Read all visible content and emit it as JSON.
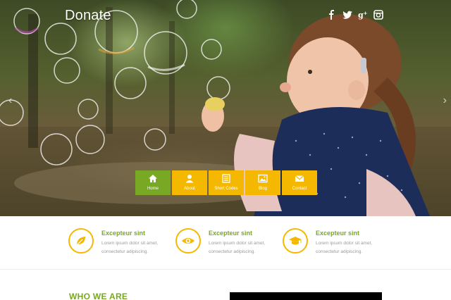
{
  "site": {
    "logo": "Donate"
  },
  "social": [
    {
      "label": "f",
      "icon": "facebook-icon"
    },
    {
      "label": "t",
      "icon": "twitter-icon"
    },
    {
      "label": "g+",
      "icon": "google-plus-icon"
    },
    {
      "label": "ig",
      "icon": "instagram-icon"
    }
  ],
  "slider": {
    "prev": "‹",
    "next": "›"
  },
  "nav": [
    {
      "label": "Home",
      "icon": "home-icon",
      "active": true
    },
    {
      "label": "About",
      "icon": "user-icon"
    },
    {
      "label": "Short Codes",
      "icon": "list-icon"
    },
    {
      "label": "Blog",
      "icon": "image-icon"
    },
    {
      "label": "Contact",
      "icon": "envelope-icon"
    }
  ],
  "features": [
    {
      "title": "Excepteur sint",
      "line1": "Lorem ipsum dolor sit amet,",
      "line2": "consectetur adipiscing.",
      "icon": "leaf-icon"
    },
    {
      "title": "Excepteur sint",
      "line1": "Lorem ipsum dolor sit amet,",
      "line2": "consectetur adipiscing.",
      "icon": "eye-icon"
    },
    {
      "title": "Excepteur sint",
      "line1": "Lorem ipsum dolor sit amet,",
      "line2": "consectetur adipiscing.",
      "icon": "graduation-cap-icon"
    }
  ],
  "section": {
    "who_we_are": "WHO WE ARE"
  },
  "colors": {
    "accent_green": "#79a825",
    "accent_yellow": "#f5b800"
  }
}
